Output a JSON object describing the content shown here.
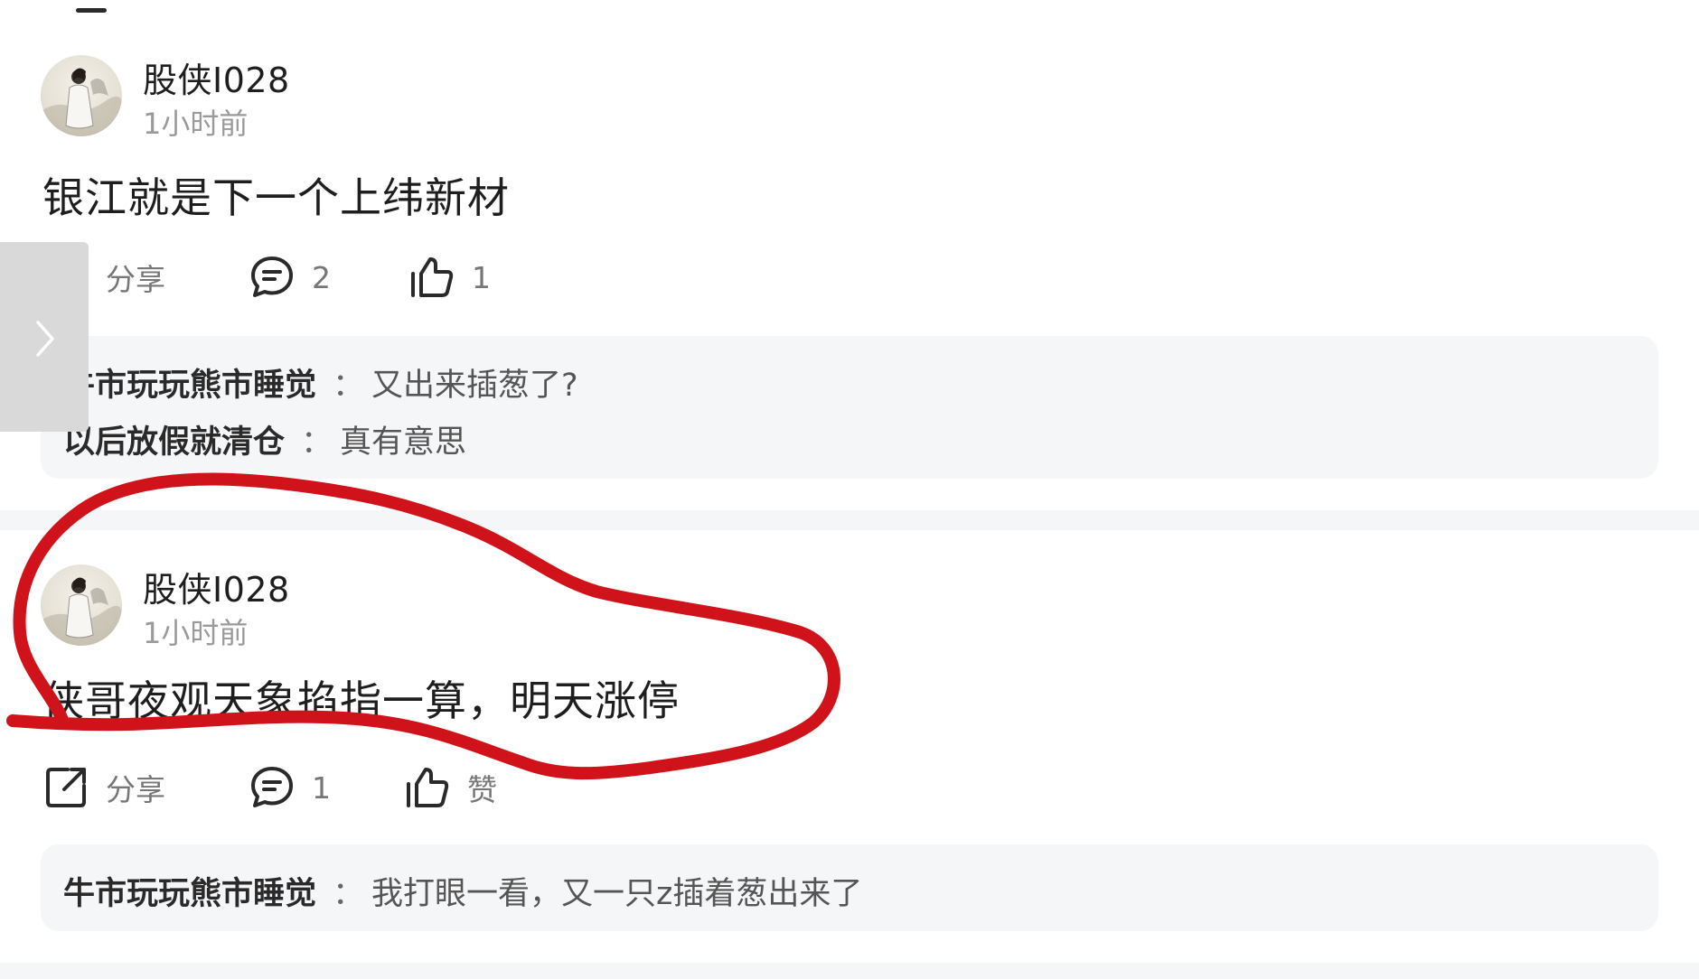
{
  "posts": [
    {
      "username": "股侠I028",
      "time": "1小时前",
      "content": "银江就是下一个上纬新材",
      "actions": {
        "share_label": "分享",
        "comment_count": "2",
        "like_label": "1"
      },
      "comments": [
        {
          "name": "牛市玩玩熊市睡觉",
          "separator": "：",
          "text": "又出来插葱了?"
        },
        {
          "name": "以后放假就清仓",
          "separator": "：",
          "text": "真有意思"
        }
      ]
    },
    {
      "username": "股侠I028",
      "time": "1小时前",
      "content": "侠哥夜观天象掐指一算，明天涨停",
      "actions": {
        "share_label": "分享",
        "comment_count": "1",
        "like_label": "赞"
      },
      "comments": [
        {
          "name": "牛市玩玩熊市睡觉",
          "separator": "：",
          "text": "我打眼一看，又一只z插着葱出来了"
        }
      ]
    }
  ],
  "icons": {
    "share": "share-icon",
    "comment": "comment-icon",
    "like": "thumbs-up-icon",
    "side": "chevron-right-icon"
  },
  "colors": {
    "annotation": "#d0121b",
    "muted": "#9a9a9a",
    "comment_bg": "#f5f6f8"
  }
}
